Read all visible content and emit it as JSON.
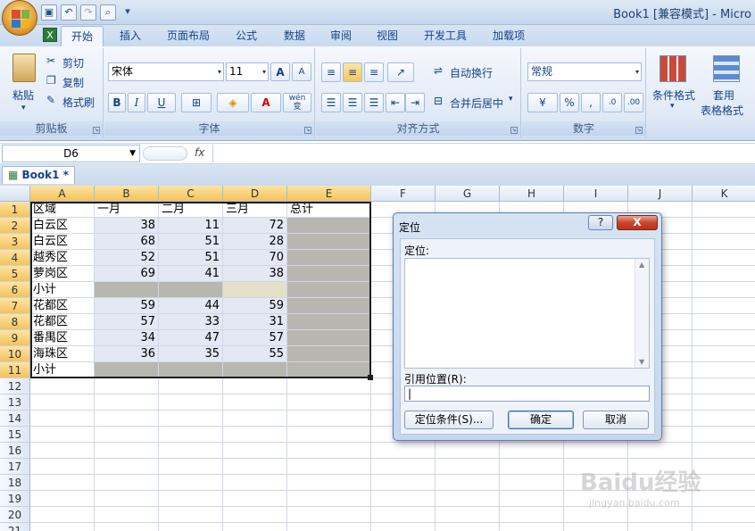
{
  "window": {
    "title": "Book1  [兼容模式] - Micro"
  },
  "tabs": [
    {
      "label": "开始",
      "active": true
    },
    {
      "label": "插入"
    },
    {
      "label": "页面布局"
    },
    {
      "label": "公式"
    },
    {
      "label": "数据"
    },
    {
      "label": "审阅"
    },
    {
      "label": "视图"
    },
    {
      "label": "开发工具"
    },
    {
      "label": "加载项"
    }
  ],
  "ribbon": {
    "clipboard": {
      "paste": "粘贴",
      "cut": "剪切",
      "copy": "复制",
      "format_painter": "格式刷",
      "group": "剪贴板"
    },
    "font": {
      "name": "宋体",
      "size": "11",
      "bold": "B",
      "italic": "I",
      "underline": "U",
      "phonetic": "wén",
      "group": "字体"
    },
    "alignment": {
      "wrap": "自动换行",
      "merge": "合并后居中",
      "group": "对齐方式"
    },
    "number": {
      "format": "常规",
      "percent": "%",
      "comma": ",",
      "group": "数字"
    },
    "styles": {
      "conditional": "条件格式",
      "table_format_1": "套用",
      "table_format_2": "表格格式"
    }
  },
  "formula_bar": {
    "name_box": "D6",
    "fx": "fx",
    "value": ""
  },
  "workbook_tab": "Book1 *",
  "sheet": {
    "columns": [
      "A",
      "B",
      "C",
      "D",
      "E",
      "F",
      "G",
      "H",
      "I",
      "J",
      "K"
    ],
    "rows": [
      "1",
      "2",
      "3",
      "4",
      "5",
      "6",
      "7",
      "8",
      "9",
      "10",
      "11",
      "12",
      "13",
      "14",
      "15",
      "16",
      "17",
      "18",
      "19",
      "20",
      "21"
    ],
    "header": [
      "区域",
      "一月",
      "二月",
      "三月",
      "总计"
    ],
    "data": [
      {
        "area": "白云区",
        "m1": "38",
        "m2": "11",
        "m3": "72"
      },
      {
        "area": "白云区",
        "m1": "68",
        "m2": "51",
        "m3": "28"
      },
      {
        "area": "越秀区",
        "m1": "52",
        "m2": "51",
        "m3": "70"
      },
      {
        "area": "萝岗区",
        "m1": "69",
        "m2": "41",
        "m3": "38"
      },
      {
        "area": "小计",
        "m1": "",
        "m2": "",
        "m3": ""
      },
      {
        "area": "花都区",
        "m1": "59",
        "m2": "44",
        "m3": "59"
      },
      {
        "area": "花都区",
        "m1": "57",
        "m2": "33",
        "m3": "31"
      },
      {
        "area": "番禺区",
        "m1": "34",
        "m2": "47",
        "m3": "57"
      },
      {
        "area": "海珠区",
        "m1": "36",
        "m2": "35",
        "m3": "55"
      },
      {
        "area": "小计",
        "m1": "",
        "m2": "",
        "m3": ""
      }
    ]
  },
  "dialog": {
    "title": "定位",
    "help": "?",
    "close": "X",
    "list_label": "定位:",
    "ref_label": "引用位置(R):",
    "ref_value": "|",
    "special_button": "定位条件(S)...",
    "ok_button": "确定",
    "cancel_button": "取消"
  },
  "watermark": {
    "brand": "Baidu经验",
    "url": "jingyan.baidu.com"
  }
}
